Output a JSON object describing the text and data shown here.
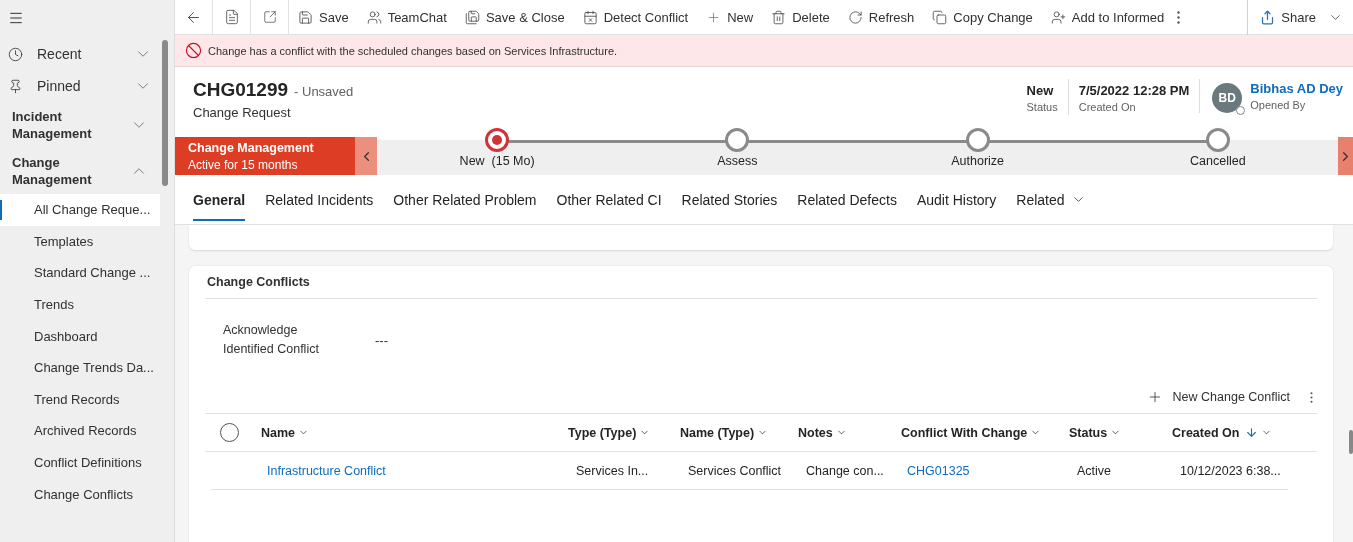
{
  "sidebar": {
    "items": [
      {
        "kind": "shortcut",
        "label": "Recent",
        "expanded": false
      },
      {
        "kind": "shortcut",
        "label": "Pinned",
        "expanded": false
      },
      {
        "kind": "group",
        "label": "Incident Management",
        "expanded": false
      },
      {
        "kind": "group",
        "label": "Change Management",
        "expanded": true,
        "children": [
          {
            "label": "All Change Reque...",
            "selected": true
          },
          {
            "label": "Templates",
            "selected": false
          },
          {
            "label": "Standard Change ...",
            "selected": false
          },
          {
            "label": "Trends",
            "selected": false
          },
          {
            "label": "Dashboard",
            "selected": false
          },
          {
            "label": "Change Trends Da...",
            "selected": false
          },
          {
            "label": "Trend Records",
            "selected": false
          },
          {
            "label": "Archived Records",
            "selected": false
          },
          {
            "label": "Conflict Definitions",
            "selected": false
          },
          {
            "label": "Change Conflicts",
            "selected": false
          }
        ]
      }
    ]
  },
  "toolbar": {
    "buttons": [
      {
        "label": "Save"
      },
      {
        "label": "TeamChat"
      },
      {
        "label": "Save & Close"
      },
      {
        "label": "Detect Conflict"
      },
      {
        "label": "New"
      },
      {
        "label": "Delete"
      },
      {
        "label": "Refresh"
      },
      {
        "label": "Copy Change"
      },
      {
        "label": "Add to Informed"
      }
    ],
    "share": "Share"
  },
  "alert": {
    "message": "Change has a conflict with the scheduled changes based on Services Infrastructure."
  },
  "header": {
    "title": "CHG01299",
    "save_state": "- Unsaved",
    "subtitle": "Change Request",
    "fields": [
      {
        "value": "New",
        "label": "Status"
      },
      {
        "value": "7/5/2022 12:28 PM",
        "label": "Created On"
      }
    ],
    "owner": {
      "initials": "BD",
      "name": "Bibhas AD Dey",
      "label": "Opened By"
    }
  },
  "process": {
    "name": "Change Management",
    "duration": "Active for 15 months",
    "stages": [
      {
        "label": "New  (15 Mo)",
        "selected": true
      },
      {
        "label": "Assess",
        "selected": false
      },
      {
        "label": "Authorize",
        "selected": false
      },
      {
        "label": "Cancelled",
        "selected": false
      }
    ]
  },
  "tabs": [
    {
      "label": "General",
      "selected": true
    },
    {
      "label": "Related Incidents",
      "selected": false
    },
    {
      "label": "Other Related Problem",
      "selected": false
    },
    {
      "label": "Other Related CI",
      "selected": false
    },
    {
      "label": "Related Stories",
      "selected": false
    },
    {
      "label": "Related Defects",
      "selected": false
    },
    {
      "label": "Audit History",
      "selected": false
    },
    {
      "label": "Related",
      "selected": false
    }
  ],
  "section": {
    "title": "Change Conflicts",
    "field": {
      "label": "Acknowledge Identified Conflict",
      "value": "---"
    },
    "grid": {
      "command": "New Change Conflict",
      "all_selected": false,
      "columns": [
        {
          "label": "Name",
          "sorted": false
        },
        {
          "label": "Type (Type)",
          "sorted": false
        },
        {
          "label": "Name (Type)",
          "sorted": false
        },
        {
          "label": "Notes",
          "sorted": false
        },
        {
          "label": "Conflict With Change",
          "sorted": false
        },
        {
          "label": "Status",
          "sorted": false
        },
        {
          "label": "Created On",
          "sorted": true
        }
      ],
      "rows": [
        {
          "cells": [
            {
              "text": "Infrastructure Conflict",
              "kind": "link"
            },
            {
              "text": "Services In...",
              "kind": "text"
            },
            {
              "text": "Services Conflict",
              "kind": "text"
            },
            {
              "text": "Change con...",
              "kind": "text"
            },
            {
              "text": "CHG01325",
              "kind": "link"
            },
            {
              "text": "Active",
              "kind": "text"
            },
            {
              "text": "10/12/2023 6:38...",
              "kind": "text"
            }
          ]
        }
      ]
    }
  }
}
